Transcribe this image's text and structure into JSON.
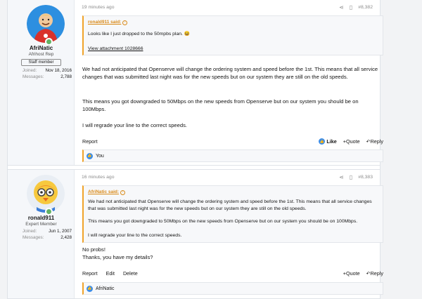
{
  "posts": [
    {
      "user": {
        "name": "AfriNatic",
        "title": "Afrihost Rep",
        "badge": "Staff member",
        "joined_label": "Joined:",
        "joined": "Nov 18, 2016",
        "messages_label": "Messages:",
        "messages": "2,788"
      },
      "time": "19 minutes ago",
      "post_no": "#8,382",
      "quote": {
        "author": "ronald911 said:",
        "line1": "Looks like I just dropped to the 50mpbs plan.",
        "emoji": "😆",
        "attachment": "View attachment 1028666"
      },
      "body": [
        "We had not anticipated that Openserve will change the ordering system and speed before the 1st. This means that all service changes that was submitted last night was for the new speeds but on our system they are still on the old speeds.",
        "This means you got downgraded to 50Mbps on the new speeds from Openserve but on our system you should be on 100Mbps.",
        "I will regrade your line to the correct speeds."
      ],
      "footer": {
        "report": "Report",
        "like": "Like",
        "quote": "+Quote",
        "reply": "Reply"
      },
      "reaction": "You"
    },
    {
      "user": {
        "name": "ronald911",
        "title": "Expert Member",
        "joined_label": "Joined:",
        "joined": "Jun 1, 2007",
        "messages_label": "Messages:",
        "messages": "2,428"
      },
      "time": "16 minutes ago",
      "post_no": "#8,383",
      "quote": {
        "author": "AfriNatic said:",
        "line1": "We had not anticipated that Openserve will change the ordering system and speed before the 1st. This means that all service changes that was submitted last night was for the new speeds but on our system they are still on the old speeds.",
        "line2": "This means you got downgraded to 50Mbps on the new speeds from Openserve but on our system you should be on 100Mbps.",
        "line3": "I will regrade your line to the correct speeds."
      },
      "body": [
        "No probs!",
        "Thanks, you have my details?"
      ],
      "footer": {
        "report": "Report",
        "edit": "Edit",
        "delete": "Delete",
        "quote": "+Quote",
        "reply": "Reply"
      },
      "reaction": "AfriNatic"
    }
  ]
}
